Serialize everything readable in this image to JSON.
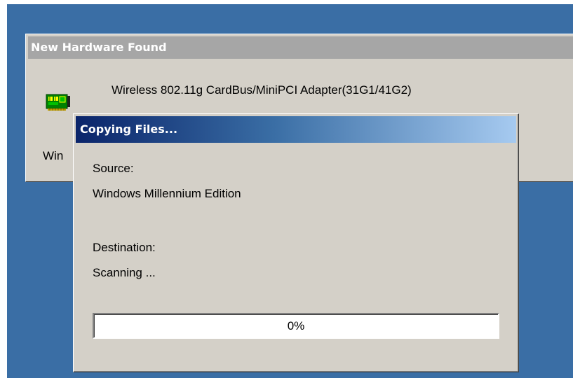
{
  "hardware_window": {
    "title": "New Hardware Found",
    "device_name": "Wireless 802.11g CardBus/MiniPCI Adapter(31G1/41G2)",
    "status_text_visible": "Win",
    "icon": "network-card-icon"
  },
  "copy_dialog": {
    "title": "Copying Files...",
    "source_label": "Source:",
    "source_value": "Windows Millennium Edition",
    "destination_label": "Destination:",
    "destination_value": "Scanning ...",
    "progress_label": "0%",
    "progress_fraction": 0
  },
  "colors": {
    "desktop": "#3a6ea5",
    "dialog_face": "#d4d0c8",
    "active_title_start": "#0a246a",
    "active_title_end": "#a6caf0",
    "inactive_title": "#a6a6a6"
  }
}
